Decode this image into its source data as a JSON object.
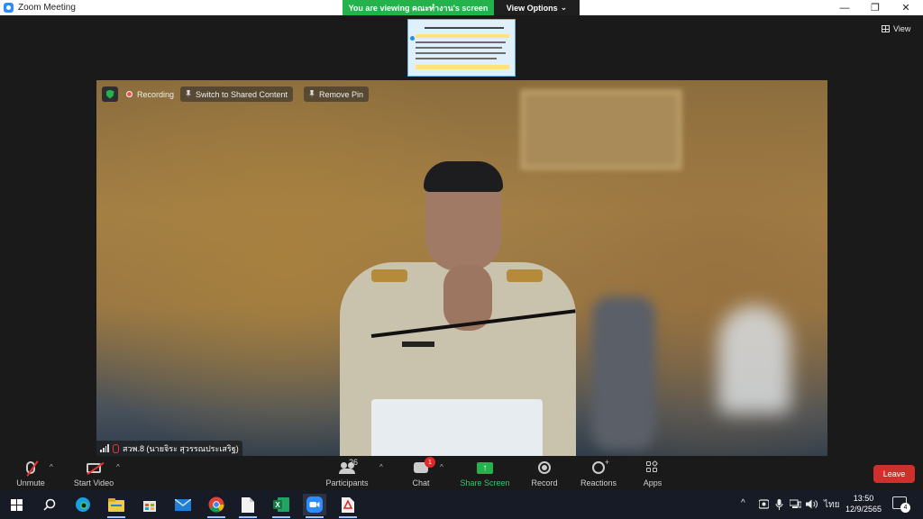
{
  "window": {
    "title": "Zoom Meeting",
    "minimize": "—",
    "restore": "❐",
    "close": "✕"
  },
  "banner": {
    "viewing_text": "You are viewing คณะทำงาน's screen",
    "view_options_label": "View Options",
    "chevron": "⌄"
  },
  "stage": {
    "view_label": "View"
  },
  "video": {
    "recording_label": "Recording",
    "switch_label": "Switch to Shared Content",
    "remove_pin_label": "Remove Pin",
    "participant_name": "สวพ.8 (นายจิระ สุวรรณประเสริฐ)"
  },
  "toolbar": {
    "unmute_label": "Unmute",
    "start_video_label": "Start Video",
    "caret": "^",
    "participants_label": "Participants",
    "participants_count": "26",
    "chat_label": "Chat",
    "chat_badge": "1",
    "share_label": "Share Screen",
    "share_arrow": "↑",
    "record_label": "Record",
    "reactions_label": "Reactions",
    "reactions_plus": "+",
    "apps_label": "Apps",
    "leave_label": "Leave"
  },
  "taskbar": {
    "chevron_up": "^",
    "input_language": "ไทย",
    "time": "13:50",
    "date": "12/9/2565",
    "notification_count": "4"
  },
  "colors": {
    "zoom_blue": "#2d8cff",
    "share_green": "#23b24c",
    "leave_red": "#d0302b",
    "badge_red": "#e02828"
  }
}
